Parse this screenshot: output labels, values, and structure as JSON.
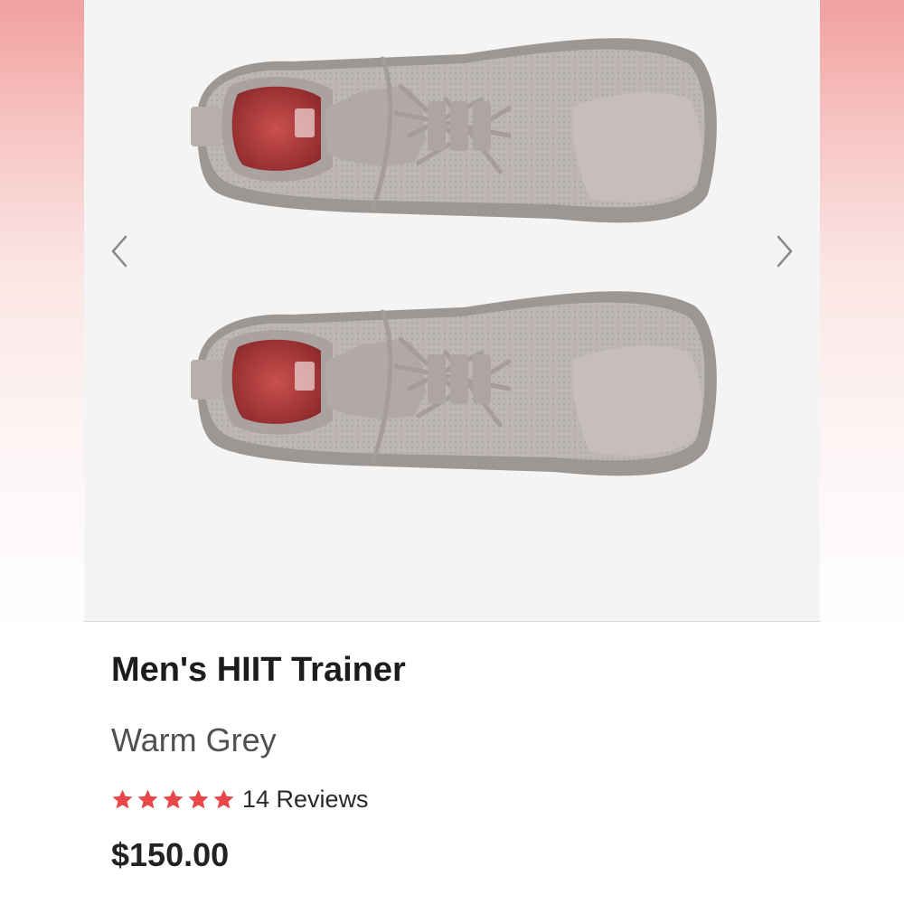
{
  "product": {
    "title": "Men's HIIT Trainer",
    "color_name": "Warm Grey",
    "rating": 5,
    "rating_max": 5,
    "reviews_label": "14 Reviews",
    "price": "$150.00"
  },
  "gallery": {
    "prev_icon": "chevron-left-icon",
    "next_icon": "chevron-right-icon"
  },
  "colors": {
    "star": "#e8474a",
    "shoe": "#b9b2ae",
    "sole": "#9d9794",
    "insole": "#b8383a"
  }
}
